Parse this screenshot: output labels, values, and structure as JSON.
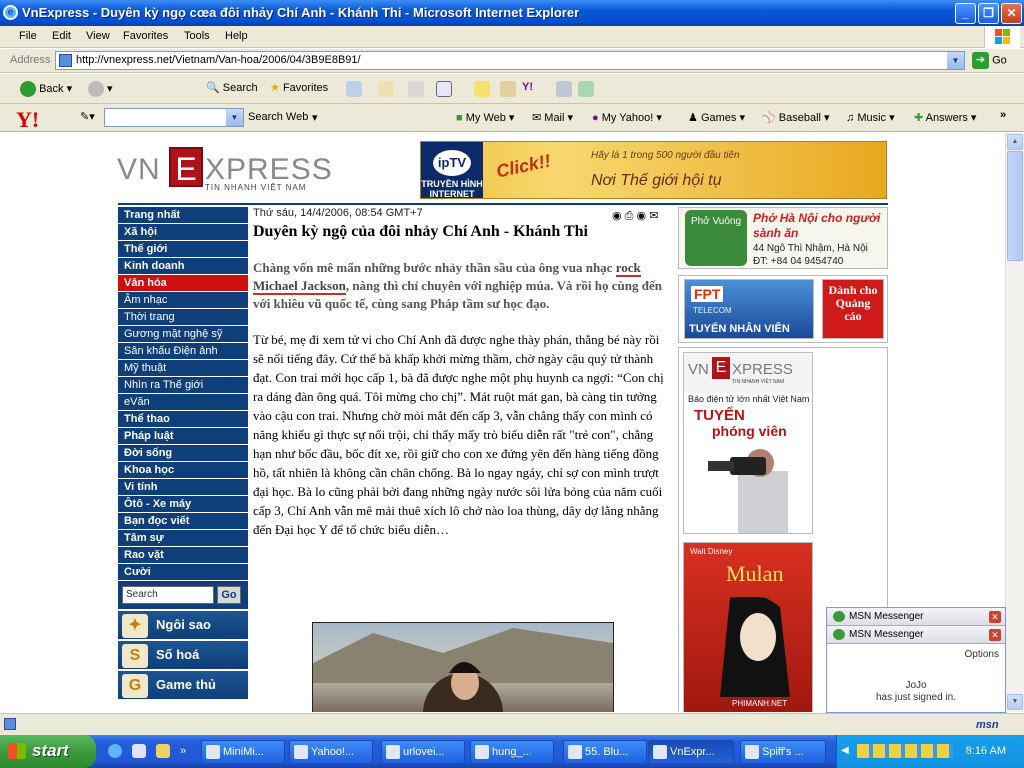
{
  "window": {
    "title": "VnExpress - Duyên kỳ ngọ cœa đôi nhảy Chí Anh - Khánh Thi - Microsoft Internet Explorer"
  },
  "menu": [
    "File",
    "Edit",
    "View",
    "Favorites",
    "Tools",
    "Help"
  ],
  "address": {
    "label": "Address",
    "url": "http://vnexpress.net/Vietnam/Van-hoa/2006/04/3B9E8B91/",
    "go": "Go"
  },
  "toolbar": {
    "back": "Back",
    "search": "Search",
    "favorites": "Favorites"
  },
  "yahoo": {
    "search_web": "Search Web",
    "my_web": "My Web",
    "mail": "Mail",
    "my_yahoo": "My Yahoo!",
    "games": "Games",
    "baseball": "Baseball",
    "music": "Music",
    "answers": "Answers"
  },
  "site": {
    "logo_vn": "VN",
    "logo_e": "E",
    "logo_xpress": "XPRESS",
    "logo_sub": "TIN NHANH VIỆT NAM",
    "banner": {
      "iptv": "ipTV",
      "iptv_sub": "TRUYỀN HÌNH INTERNET",
      "click": "Click!!",
      "hay": "Hãy là 1 trong 500 người đầu tiên",
      "noi": "Nơi Thế giới hội tụ"
    }
  },
  "nav": {
    "items": [
      {
        "label": "Trang nhất",
        "sub": false
      },
      {
        "label": "Xã hội",
        "sub": false
      },
      {
        "label": "Thế giới",
        "sub": false
      },
      {
        "label": "Kinh doanh",
        "sub": false
      },
      {
        "label": "Văn hóa",
        "sub": false,
        "selected": true
      },
      {
        "label": "Âm nhạc",
        "sub": true
      },
      {
        "label": "Thời trang",
        "sub": true
      },
      {
        "label": "Gương mặt nghệ sỹ",
        "sub": true
      },
      {
        "label": "Sân khấu Điện ảnh",
        "sub": true
      },
      {
        "label": "Mỹ thuật",
        "sub": true
      },
      {
        "label": "Nhìn ra Thế giới",
        "sub": true
      },
      {
        "label": "eVăn",
        "sub": true
      },
      {
        "label": "Thể thao",
        "sub": false
      },
      {
        "label": "Pháp luật",
        "sub": false
      },
      {
        "label": "Đời sống",
        "sub": false
      },
      {
        "label": "Khoa học",
        "sub": false
      },
      {
        "label": "Vi tính",
        "sub": false
      },
      {
        "label": "Ôtô - Xe máy",
        "sub": false
      },
      {
        "label": "Bạn đọc viết",
        "sub": false
      },
      {
        "label": "Tâm sự",
        "sub": false
      },
      {
        "label": "Rao vặt",
        "sub": false
      },
      {
        "label": "Cười",
        "sub": false
      }
    ],
    "search_placeholder": "Search",
    "search_go": "Go",
    "big": [
      "Ngôi sao",
      "Số hoá",
      "Game thủ"
    ]
  },
  "article": {
    "date": "Thứ sáu, 14/4/2006, 08:54 GMT+7",
    "title": "Duyên kỳ ngộ của đôi nhảy Chí Anh - Khánh Thi",
    "lead_before": "Chàng vốn mê mẩn những bước nhảy thần sầu của ông vua nhạc ",
    "lead_link": "rock Michael Jackson",
    "lead_after": ", nàng thì chỉ chuyên với nghiệp múa. Và rồi họ cùng đến với khiêu vũ quốc tế, cùng sang Pháp tầm sư học đạo.",
    "body": "Từ bé, mẹ đi xem tử vi cho Chí Anh đã được nghe thày phán, thằng bé này rồi sẽ nổi tiếng đây. Cứ thế bà khấp khởi mừng thầm, chờ ngày cậu quý tử thành đạt. Con trai mới học cấp 1, bà đã được nghe một phụ huynh ca ngợi: “Con chị ra dáng đàn ông quá. Tôi mừng cho chị”. Mát ruột mát gan, bà càng tin tưởng vào cậu con trai. Nhưng chờ mỏi mắt đến cấp 3, vẫn chẳng thấy con mình có năng khiếu gì thực sự nổi trội, chỉ thấy mấy trò biểu diễn rất \"trẻ con\", chẳng hạn như bốc đầu, bốc đít xe, rồi giữ cho con xe đứng yên đến hàng tiếng đồng hồ, tất nhiên là không cần chân chống. Bà lo ngay ngáy, chỉ sợ con mình trượt đại học. Bà lo cũng phải bởi đang những ngày nước sôi lửa bỏng của năm cuối cấp 3, Chí Anh vẫn mê mải thuê xích lô chở nào loa thùng, dây dợ lằng nhằng đến Đại học Y để tổ chức biểu diễn…"
  },
  "ads": {
    "pho_brand": "Phở Vuông",
    "pho_title": "Phở Hà Nội cho người sành ăn",
    "pho_addr": "44 Ngô Thì Nhậm, Hà Nội",
    "pho_tel": "ĐT: +84 04 9454740",
    "fpt": "FPT",
    "fpt_sub": "TELECOM",
    "fpt_tuyen": "TUYỂN NHÂN VIÊN",
    "danh_cho": "Dành cho Quảng cáo",
    "vnx_sub": "Báo điện tử lớn nhất Việt Nam",
    "tuyen": "TUYỂN",
    "phong_vien": "phóng viên",
    "mulan": "Mulan",
    "disney": "Walt Disney",
    "phimanh": "PHIMANH.NET"
  },
  "msn": {
    "bar1": "MSN Messenger",
    "bar2": "MSN Messenger",
    "options": "Options",
    "name": "JoJo",
    "msg": "has just signed in.",
    "logo": "msn"
  },
  "taskbar": {
    "start": "start",
    "buttons": [
      "MiniMi...",
      "Yahoo!...",
      "urlovei...",
      "hung_...",
      "55. Blu...",
      "VnExpr...",
      "Spiff's ..."
    ],
    "clock": "8:16 AM"
  }
}
